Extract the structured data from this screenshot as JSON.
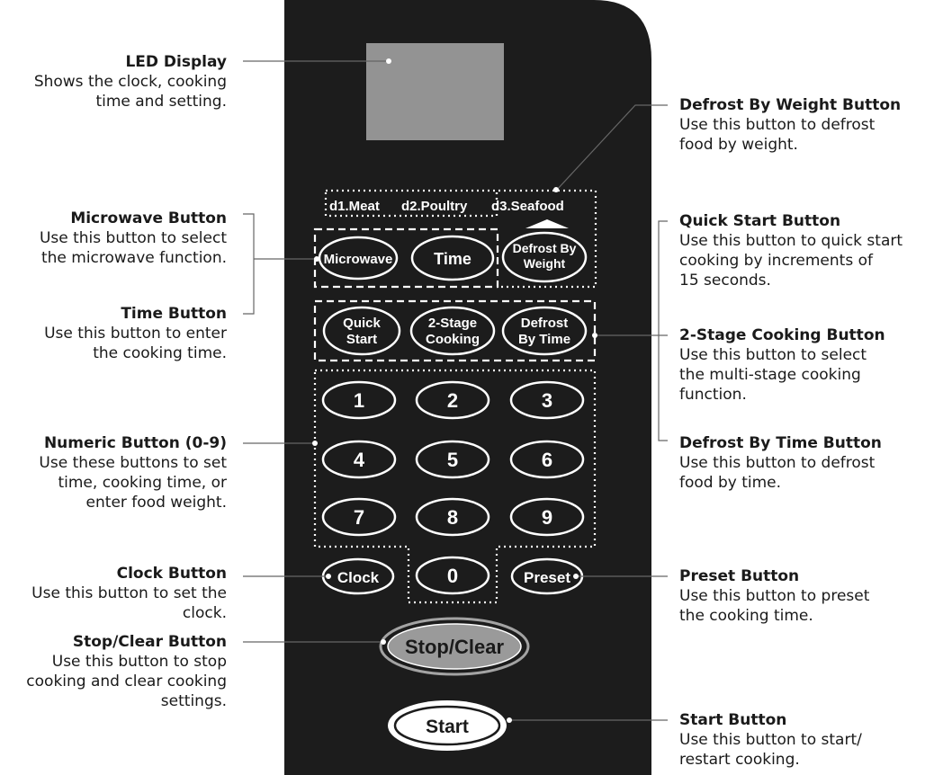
{
  "panel": {
    "defrost_categories": [
      "d1.Meat",
      "d2.Poultry",
      "d3.Seafood"
    ],
    "buttons": {
      "microwave": "Microwave",
      "time": "Time",
      "defrost_by_weight": [
        "Defrost By",
        "Weight"
      ],
      "quick_start": [
        "Quick",
        "Start"
      ],
      "two_stage": [
        "2-Stage",
        "Cooking"
      ],
      "defrost_by_time": [
        "Defrost",
        "By Time"
      ],
      "numeric": [
        "1",
        "2",
        "3",
        "4",
        "5",
        "6",
        "7",
        "8",
        "9",
        "0"
      ],
      "clock": "Clock",
      "preset": "Preset",
      "stop_clear": "Stop/Clear",
      "start": "Start"
    },
    "colors": {
      "panel": "#1c1c1c",
      "display": "#939393",
      "stop_clear": "#9a9a9a",
      "start": "#ffffff"
    }
  },
  "labels": {
    "led_display": {
      "title": "LED Display",
      "desc": [
        "Shows the clock, cooking",
        "time and setting."
      ]
    },
    "microwave_button": {
      "title": "Microwave Button",
      "desc": [
        "Use this button to select",
        "the microwave function."
      ]
    },
    "time_button": {
      "title": "Time Button",
      "desc": [
        "Use this button to enter",
        "the cooking time."
      ]
    },
    "numeric_button": {
      "title": "Numeric Button (0-9)",
      "desc": [
        "Use these buttons to set",
        "time, cooking time, or",
        "enter food weight."
      ]
    },
    "clock_button": {
      "title": "Clock Button",
      "desc": [
        "Use this button to set the",
        "clock."
      ]
    },
    "stop_clear_button": {
      "title": "Stop/Clear Button",
      "desc": [
        "Use this button to stop",
        "cooking and clear cooking",
        "settings."
      ]
    },
    "defrost_weight_button": {
      "title": "Defrost By Weight Button",
      "desc": [
        "Use this button to defrost",
        "food by weight."
      ]
    },
    "quick_start_button": {
      "title": "Quick Start Button",
      "desc": [
        "Use this button to quick start",
        "cooking by increments of",
        "15 seconds."
      ]
    },
    "two_stage_button": {
      "title": "2-Stage Cooking Button",
      "desc": [
        "Use this button to select",
        "the multi-stage cooking",
        "function."
      ]
    },
    "defrost_time_button": {
      "title": "Defrost By Time Button",
      "desc": [
        "Use this button to defrost",
        "food by time."
      ]
    },
    "preset_button": {
      "title": "Preset Button",
      "desc": [
        "Use this button to preset",
        "the cooking time."
      ]
    },
    "start_button": {
      "title": "Start Button",
      "desc": [
        "Use this button to start/",
        "restart cooking."
      ]
    }
  }
}
